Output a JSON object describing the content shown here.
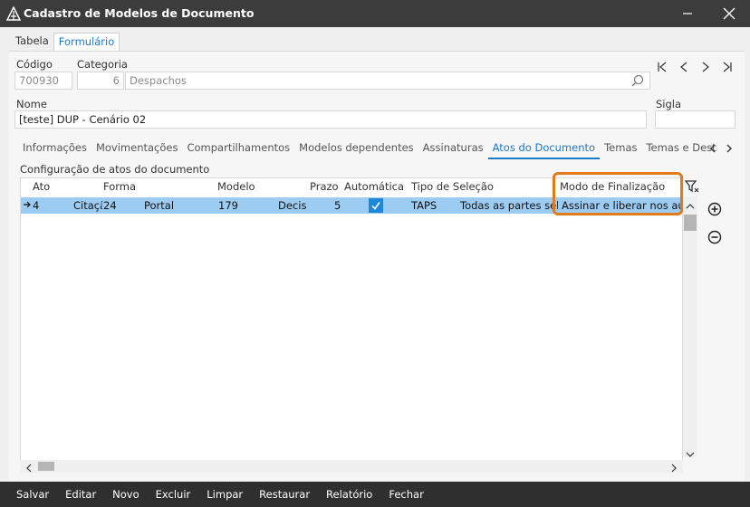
{
  "window": {
    "title": "Cadastro de Modelos de Documento"
  },
  "outer_tabs": [
    "Tabela",
    "Formulário"
  ],
  "form": {
    "codigo_label": "Código",
    "codigo_value": "700930",
    "categoria_label": "Categoria",
    "categoria_num": "6",
    "categoria_name": "Despachos",
    "nome_label": "Nome",
    "nome_value": "[teste] DUP - Cenário 02",
    "sigla_label": "Sigla",
    "sigla_value": ""
  },
  "inner_tabs": [
    "Informações",
    "Movimentações",
    "Compartilhamentos",
    "Modelos dependentes",
    "Assinaturas",
    "Atos do Documento",
    "Temas",
    "Temas e Destir"
  ],
  "grid": {
    "section_title": "Configuração de atos do documento",
    "columns": [
      "Ato",
      "Forma",
      "Modelo",
      "Prazo",
      "Automática",
      "Tipo de Seleção",
      "Modo de Finalização"
    ],
    "row": {
      "ato": "4",
      "ato_desc": "Citaçã",
      "forma": "24",
      "forma_desc": "Portal",
      "modelo": "179",
      "modelo_desc": "Decisã",
      "prazo": "5",
      "tipo": "TAPS",
      "tipo_desc": "Todas as partes sel",
      "modo": "Assinar e liberar nos auto"
    }
  },
  "toolbar": [
    "Salvar",
    "Editar",
    "Novo",
    "Excluir",
    "Limpar",
    "Restaurar",
    "Relatório",
    "Fechar"
  ],
  "colors": {
    "accent": "#1e78c8",
    "highlight": "#e07b1a",
    "selected_row": "#9dccf3"
  }
}
